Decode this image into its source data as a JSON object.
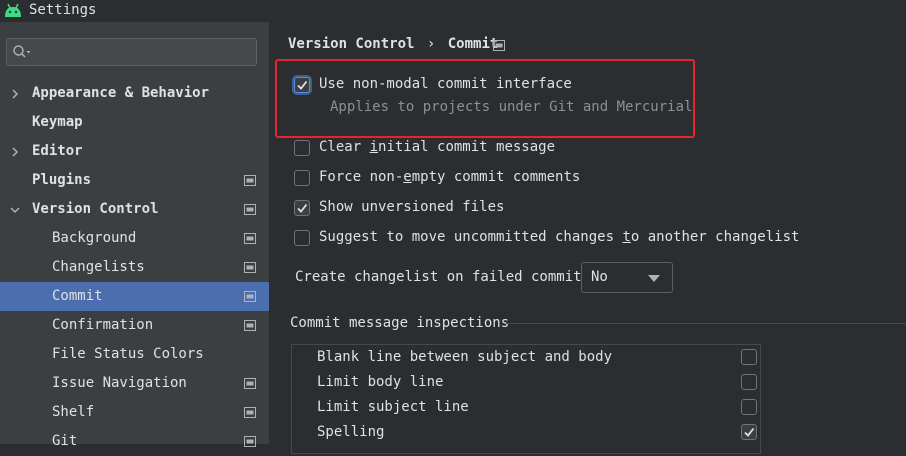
{
  "window": {
    "title": "Settings"
  },
  "sidebar": {
    "search": {
      "placeholder": ""
    },
    "items": [
      {
        "label": "Appearance & Behavior",
        "expandable": true,
        "expanded": false,
        "bold": true,
        "icon": "none"
      },
      {
        "label": "Keymap",
        "expandable": false,
        "bold": true,
        "icon": "none"
      },
      {
        "label": "Editor",
        "expandable": true,
        "expanded": false,
        "bold": true,
        "icon": "none"
      },
      {
        "label": "Plugins",
        "expandable": false,
        "bold": true,
        "icon": "project-settings-icon"
      },
      {
        "label": "Version Control",
        "expandable": true,
        "expanded": true,
        "bold": true,
        "icon": "project-settings-icon"
      },
      {
        "label": "Background",
        "icon": "project-settings-icon"
      },
      {
        "label": "Changelists",
        "icon": "project-settings-icon"
      },
      {
        "label": "Commit",
        "selected": true,
        "icon": "project-settings-icon"
      },
      {
        "label": "Confirmation",
        "icon": "project-settings-icon"
      },
      {
        "label": "File Status Colors",
        "icon": "none"
      },
      {
        "label": "Issue Navigation",
        "icon": "project-settings-icon"
      },
      {
        "label": "Shelf",
        "icon": "project-settings-icon"
      },
      {
        "label": "Git",
        "icon": "project-settings-icon"
      }
    ]
  },
  "breadcrumb": {
    "parent": "Version Control",
    "separator": "›",
    "current": "Commit"
  },
  "options": {
    "non_modal": {
      "label": "Use non-modal commit interface",
      "checked": true,
      "hint": "Applies to projects under Git and Mercurial"
    },
    "clear_initial": {
      "label_before": "Clear ",
      "mnemonic": "i",
      "label_after": "nitial commit message",
      "checked": false
    },
    "force_non_empty": {
      "label_before": "Force non-",
      "mnemonic": "e",
      "label_after": "mpty commit comments",
      "checked": false
    },
    "show_unversioned": {
      "label": "Show unversioned files",
      "checked": true
    },
    "suggest_move": {
      "label_before": "Suggest to move uncommitted changes ",
      "mnemonic": "t",
      "label_after": "o another changelist",
      "checked": false
    }
  },
  "failed_commit": {
    "label": "Create changelist on failed commit:",
    "value": "No"
  },
  "inspections": {
    "title": "Commit message inspections",
    "rows": [
      {
        "label": "Blank line between subject and body",
        "checked": false
      },
      {
        "label": "Limit body line",
        "checked": false
      },
      {
        "label": "Limit subject line",
        "checked": false
      },
      {
        "label": "Spelling",
        "checked": true
      }
    ]
  },
  "colors": {
    "accent": "#4b6eaf",
    "highlight_border": "#e3262d",
    "background": "#2b2d30",
    "sidebar": "#3c3f41"
  }
}
